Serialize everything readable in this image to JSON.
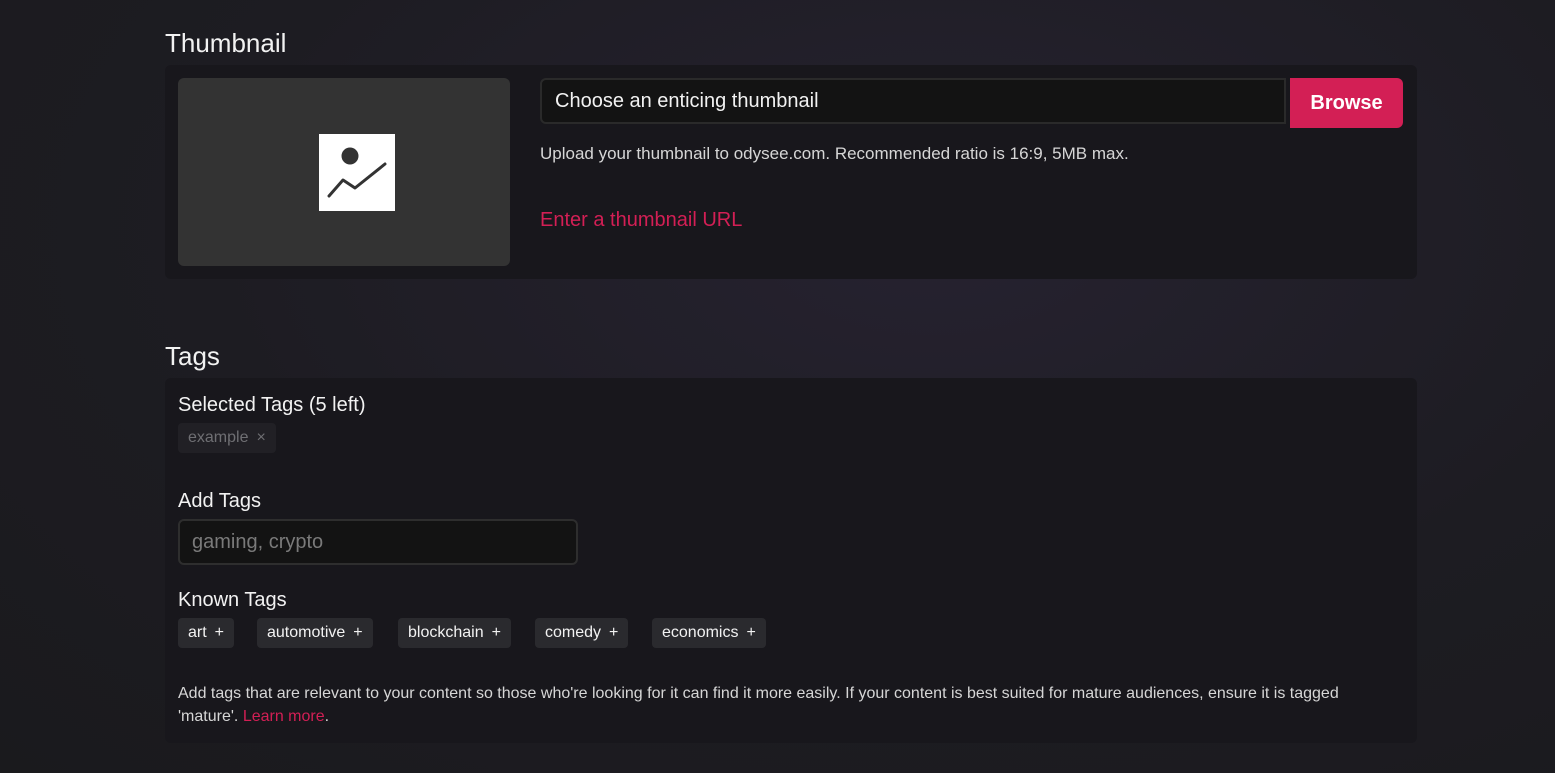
{
  "thumbnail": {
    "title": "Thumbnail",
    "input_value": "Choose an enticing thumbnail",
    "browse_label": "Browse",
    "help": "Upload your thumbnail to odysee.com. Recommended ratio is 16:9, 5MB max.",
    "url_link": "Enter a thumbnail URL",
    "placeholder_icon": "image-placeholder-icon"
  },
  "tags": {
    "title": "Tags",
    "selected_label": "Selected Tags (5 left)",
    "selected": [
      {
        "label": "example",
        "remove_symbol": "×"
      }
    ],
    "add_label": "Add Tags",
    "input_placeholder": "gaming, crypto",
    "known_label": "Known Tags",
    "known": [
      {
        "label": "art",
        "add_symbol": "+"
      },
      {
        "label": "automotive",
        "add_symbol": "+"
      },
      {
        "label": "blockchain",
        "add_symbol": "+"
      },
      {
        "label": "comedy",
        "add_symbol": "+"
      },
      {
        "label": "economics",
        "add_symbol": "+"
      }
    ],
    "help_text": "Add tags that are relevant to your content so those who're looking for it can find it more easily. If your content is best suited for mature audiences, ensure it is tagged 'mature'.",
    "learn_more": "Learn more",
    "help_end": "."
  },
  "colors": {
    "accent": "#d31f55",
    "card_background": "#18171c",
    "page_background": "#1d1c22"
  }
}
